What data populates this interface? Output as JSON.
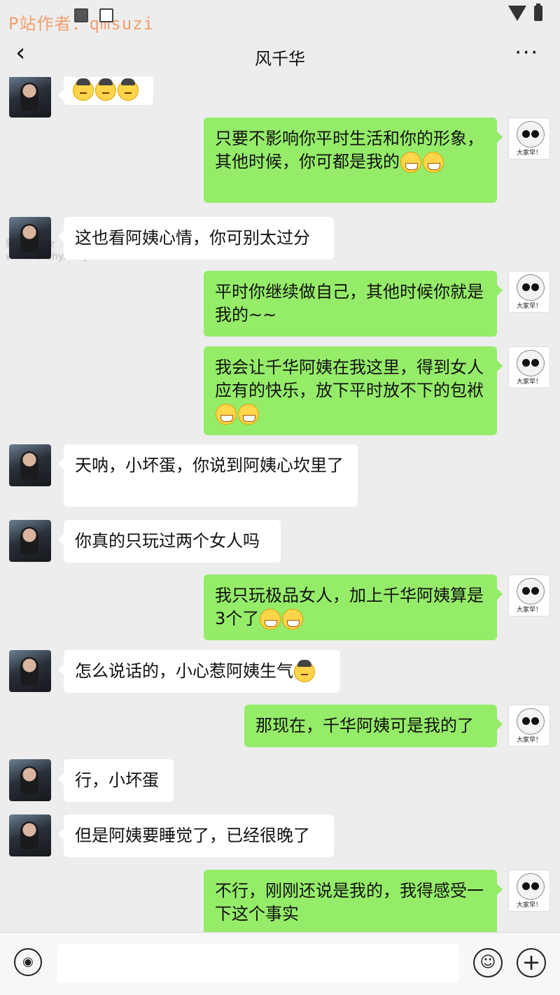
{
  "status_bar": {
    "watermark": "P站作者：qmsuzi"
  },
  "header": {
    "back_icon": "‹",
    "title": "风千华",
    "more_icon": "···"
  },
  "site_watermark": {
    "line1": "新浪 K9Jkz",
    "line2": "www.lanshy.co/qmsuzi"
  },
  "avatar_me_caption": "大家早！",
  "messages": [
    {
      "side": "left",
      "text": "",
      "emoji": [
        "angry",
        "angry",
        "angry"
      ]
    },
    {
      "side": "right",
      "text": "只要不影响你平时生活和你的形象，其他时候，你可都是我的",
      "emoji": [
        "grin",
        "grin"
      ]
    },
    {
      "side": "left",
      "text": "这也看阿姨心情，你可别太过分",
      "emoji": []
    },
    {
      "side": "right",
      "text": "平时你继续做自己，其他时候你就是我的~~",
      "emoji": []
    },
    {
      "side": "right",
      "text": "我会让千华阿姨在我这里，得到女人应有的快乐，放下平时放不下的包袱",
      "emoji": [
        "grin",
        "grin"
      ]
    },
    {
      "side": "left",
      "text": "天呐，小坏蛋，你说到阿姨心坎里了",
      "emoji": []
    },
    {
      "side": "left",
      "text": "你真的只玩过两个女人吗",
      "emoji": []
    },
    {
      "side": "right",
      "text": "我只玩极品女人，加上千华阿姨算是3个了",
      "emoji": [
        "grin",
        "grin"
      ]
    },
    {
      "side": "left",
      "text": "怎么说话的，小心惹阿姨生气",
      "emoji": [
        "angry"
      ]
    },
    {
      "side": "right",
      "text": "那现在，千华阿姨可是我的了",
      "emoji": []
    },
    {
      "side": "left",
      "text": "行，小坏蛋",
      "emoji": []
    },
    {
      "side": "left",
      "text": "但是阿姨要睡觉了，已经很晚了",
      "emoji": []
    },
    {
      "side": "right",
      "text": "不行，刚刚还说是我的，我得感受一下这个事实",
      "emoji": []
    }
  ],
  "input_bar": {
    "voice_icon": "voice-icon",
    "input_placeholder": "",
    "emoji_icon": "smiley-icon",
    "plus_icon": "plus-icon"
  }
}
